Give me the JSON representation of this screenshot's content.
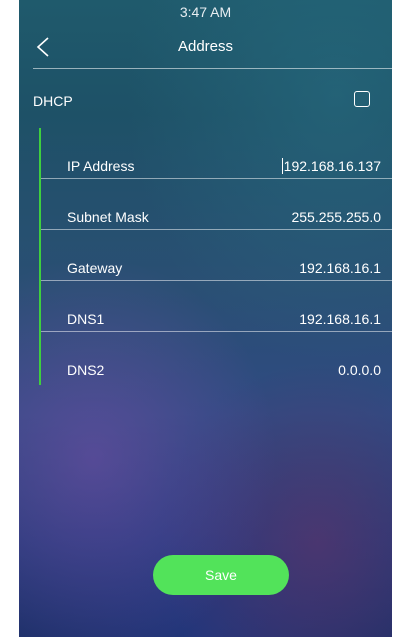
{
  "status_bar": {
    "time": "3:47 AM"
  },
  "header": {
    "title": "Address",
    "back_icon": "chevron-left-icon"
  },
  "dhcp": {
    "label": "DHCP",
    "checked": false
  },
  "fields": [
    {
      "label": "IP Address",
      "value": "192.168.16.137"
    },
    {
      "label": "Subnet Mask",
      "value": "255.255.255.0"
    },
    {
      "label": "Gateway",
      "value": "192.168.16.1"
    },
    {
      "label": "DNS1",
      "value": "192.168.16.1"
    },
    {
      "label": "DNS2",
      "value": "0.0.0.0"
    }
  ],
  "save_label": "Save",
  "colors": {
    "accent": "#52e35a",
    "panel_border": "#3ecf3e"
  }
}
